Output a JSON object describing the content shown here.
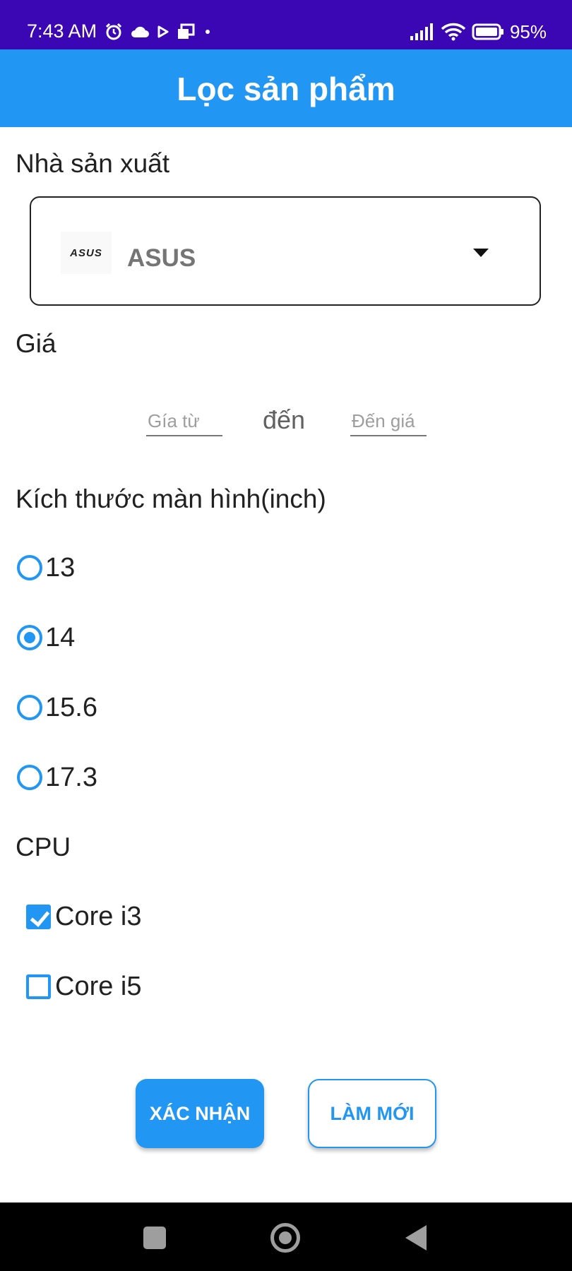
{
  "status_bar": {
    "time": "7:43 AM",
    "battery": "95%",
    "icons": [
      "alarm-icon",
      "cloud-icon",
      "play-icon",
      "message-icon",
      "dot-icon",
      "signal-icon",
      "wifi-icon",
      "battery-icon"
    ],
    "background": "#3b06b3"
  },
  "app_bar": {
    "title": "Lọc sản phẩm",
    "background": "#2196f3"
  },
  "manufacturer": {
    "label": "Nhà sản xuất",
    "selected": "ASUS",
    "logo_text": "ASUS"
  },
  "price": {
    "label": "Giá",
    "from_placeholder": "Gía từ",
    "to_placeholder": "Đến giá",
    "separator": "đến"
  },
  "screen_size": {
    "label": "Kích thước màn hình(inch)",
    "options": [
      {
        "label": "13",
        "checked": false
      },
      {
        "label": "14",
        "checked": true
      },
      {
        "label": "15.6",
        "checked": false
      },
      {
        "label": "17.3",
        "checked": false
      }
    ]
  },
  "cpu": {
    "label": "CPU",
    "options": [
      {
        "label": "Core i3",
        "checked": true
      },
      {
        "label": "Core i5",
        "checked": false
      }
    ]
  },
  "buttons": {
    "confirm": "XÁC NHẬN",
    "reset": "LÀM MỚI"
  },
  "accent_color": "#2196f3"
}
